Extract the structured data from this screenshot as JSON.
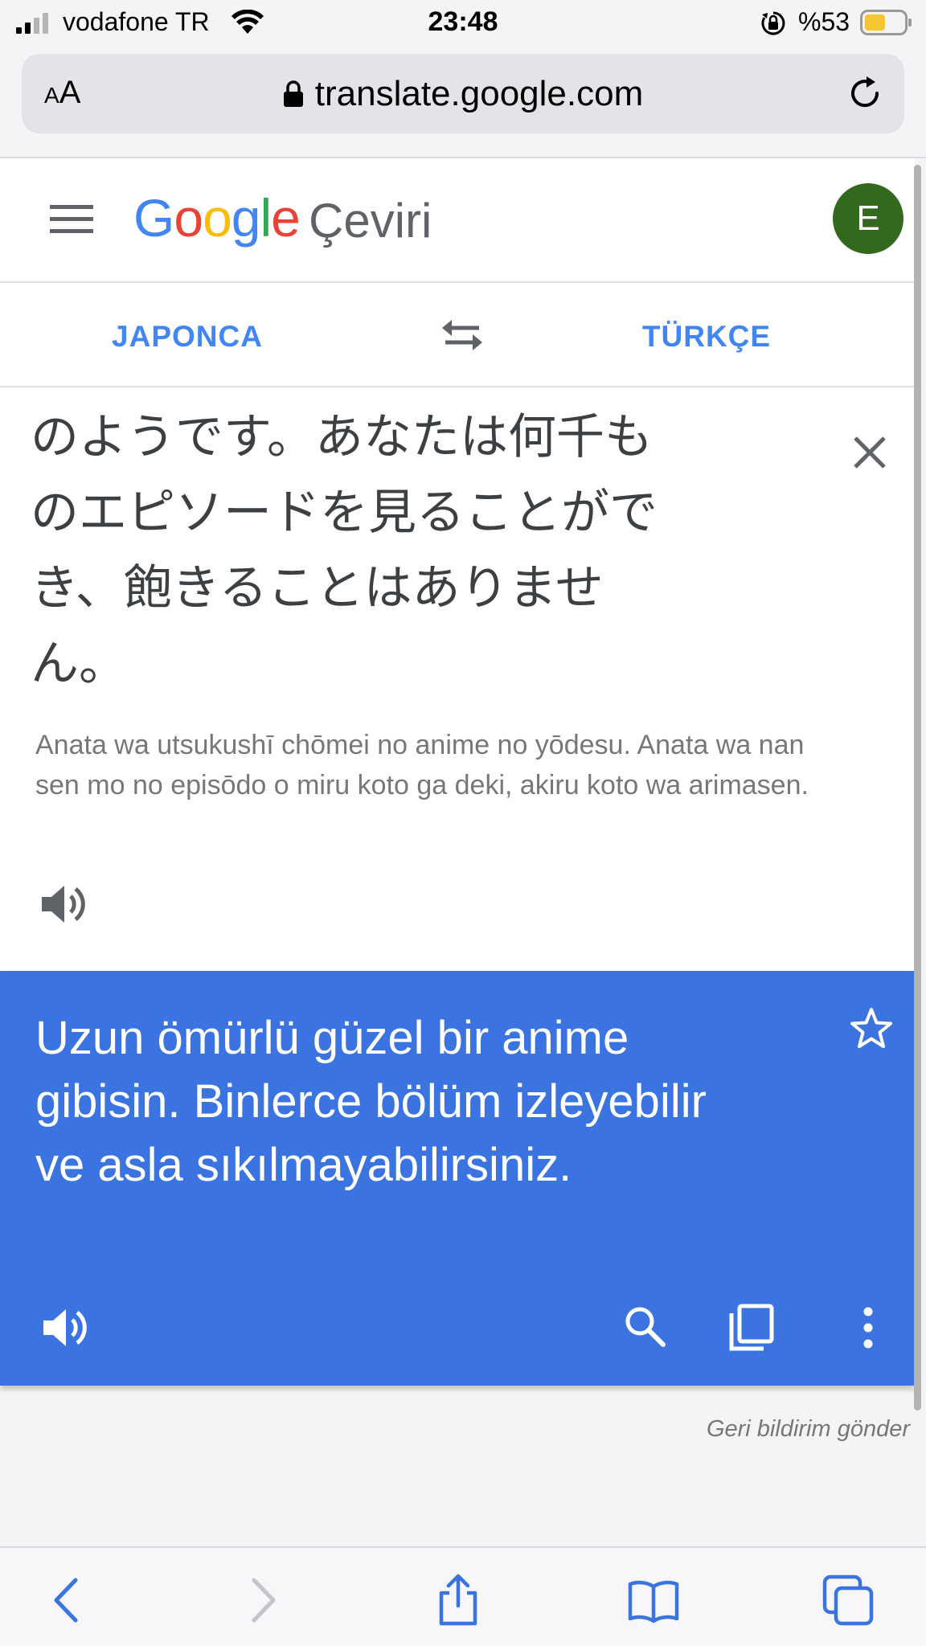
{
  "status_bar": {
    "carrier": "vodafone TR",
    "time": "23:48",
    "battery_percent": "%53",
    "battery_level": 0.53
  },
  "browser": {
    "text_size_label_small": "A",
    "text_size_label_large": "A",
    "url": "translate.google.com"
  },
  "app": {
    "logo_letters": [
      "G",
      "o",
      "o",
      "g",
      "l",
      "e"
    ],
    "product_name": "Çeviri",
    "avatar_initial": "E"
  },
  "languages": {
    "source": "JAPONCA",
    "target": "TÜRKÇE"
  },
  "source": {
    "lines": [
      "のようです。あなたは何千も",
      "のエピソードを見ることがで",
      "き、飽きることはありませ",
      "ん。"
    ],
    "romanization": "Anata wa utsukushī chōmei no anime no yōdesu. Anata wa nan sen mo no episōdo o miru koto ga deki, akiru koto wa arimasen."
  },
  "result": {
    "lines": [
      "Uzun ömürlü güzel bir anime",
      "gibisin. Binlerce bölüm izleyebilir",
      "ve asla sıkılmayabilirsiniz."
    ]
  },
  "feedback_link": "Geri bildirim gönder",
  "colors": {
    "accent": "#4285f4",
    "result_card": "#3b74e0",
    "avatar": "#33691e"
  },
  "icons": [
    "menu-icon",
    "swap-icon",
    "close-icon",
    "speaker-icon",
    "star-icon",
    "search-icon",
    "copy-icon",
    "more-vert-icon",
    "back-icon",
    "forward-icon",
    "share-icon",
    "bookmarks-icon",
    "tabs-icon"
  ]
}
